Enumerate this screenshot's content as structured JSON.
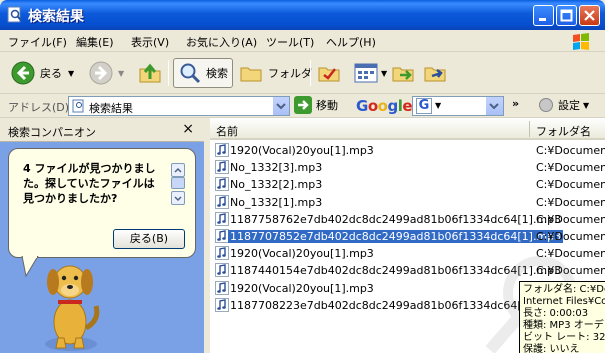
{
  "window": {
    "title": "検索結果"
  },
  "menu": [
    "ファイル(F)",
    "編集(E)",
    "表示(V)",
    "お気に入り(A)",
    "ツール(T)",
    "ヘルプ(H)"
  ],
  "toolbar": {
    "back": "戻る",
    "search": "検索",
    "folders": "フォルダ"
  },
  "address": {
    "label": "アドレス(D)",
    "value": "検索結果",
    "go": "移動"
  },
  "google": {
    "logo": "Google",
    "settings": "設定"
  },
  "left_pane": {
    "title": "検索コンパニオン",
    "close": "×",
    "message": "4 ファイルが見つかりました。探していたファイルは見つかりましたか?",
    "back_button": "戻る(B)"
  },
  "list": {
    "columns": [
      "名前",
      "フォルダ名"
    ],
    "rows": [
      {
        "name": "1920(Vocal)20you[1].mp3",
        "folder": "C:¥Document"
      },
      {
        "name": "No_1332[3].mp3",
        "folder": "C:¥Document"
      },
      {
        "name": "No_1332[2].mp3",
        "folder": "C:¥Document"
      },
      {
        "name": "No_1332[1].mp3",
        "folder": "C:¥Document"
      },
      {
        "name": "1187758762e7db402dc8dc2499ad81b06f1334dc64[1].mp3",
        "folder": "C:¥Document"
      },
      {
        "name": "1187707852e7db402dc8dc2499ad81b06f1334dc64[1].mp3",
        "folder": "C:¥Document",
        "selected": true
      },
      {
        "name": "1920(Vocal)20you[1].mp3",
        "folder": "C:¥Document"
      },
      {
        "name": "1187440154e7db402dc8dc2499ad81b06f1334dc64[1].mp3",
        "folder": "C:¥Document"
      },
      {
        "name": "1920(Vocal)20you[1].mp3",
        "folder": "C:¥Document"
      },
      {
        "name": "1187708223e7db402dc8dc2499ad81b06f1334dc64[1].mp3",
        "folder": "C:¥Document"
      }
    ]
  },
  "tooltip": {
    "lines": [
      "フォルダ名: C:¥Do",
      "Internet Files¥Co",
      "長さ: 0:00:03",
      "種類: MP3 オーデ",
      "ビット レート: 320k",
      "保護: いいえ"
    ]
  }
}
